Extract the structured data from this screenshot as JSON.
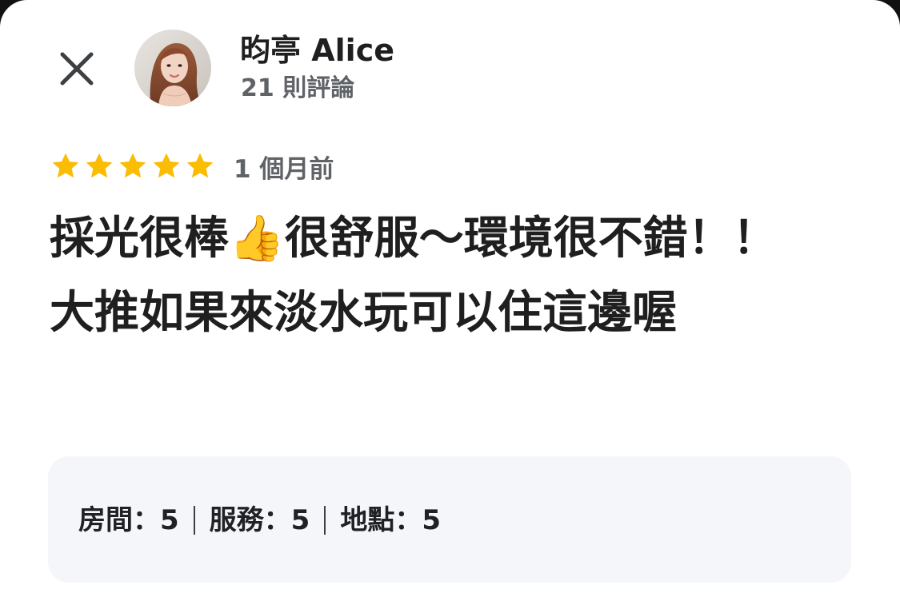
{
  "reviewer": {
    "name": "昀亭 Alice",
    "review_count": "21 則評論"
  },
  "review": {
    "rating": 5,
    "max_rating": 5,
    "date": "1 個月前",
    "text": "採光很棒👍很舒服～環境很不錯！！大推如果來淡水玩可以住這邊喔"
  },
  "sub_ratings": [
    {
      "label": "房間：5"
    },
    {
      "label": "服務：5"
    },
    {
      "label": "地點：5"
    }
  ],
  "colors": {
    "star": "#FBBC04",
    "text_primary": "#1f1f1f",
    "text_secondary": "#5f6368",
    "ratings_bg": "#f4f6f9"
  },
  "icons": {
    "close": "close-icon",
    "star": "star-icon",
    "avatar": "avatar"
  }
}
